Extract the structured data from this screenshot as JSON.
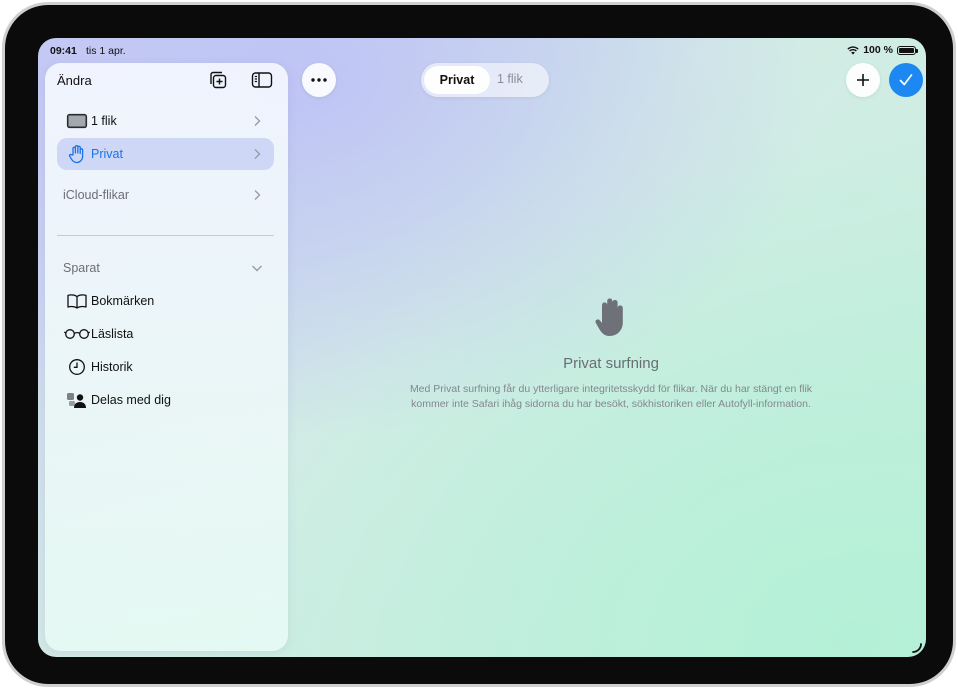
{
  "status_bar": {
    "time": "09:41",
    "date": "tis 1 apr.",
    "battery": "100 %"
  },
  "sidebar": {
    "edit_label": "Ändra",
    "items": [
      {
        "label": "1 flik",
        "icon": "tablet-icon"
      },
      {
        "label": "Privat",
        "icon": "hand-icon",
        "selected": true
      },
      {
        "label": "iCloud-flikar"
      }
    ],
    "saved_section": "Sparat",
    "saved_items": [
      {
        "label": "Bokmärken",
        "icon": "book-icon"
      },
      {
        "label": "Läslista",
        "icon": "glasses-icon"
      },
      {
        "label": "Historik",
        "icon": "clock-icon"
      },
      {
        "label": "Delas med dig",
        "icon": "shared-with-you-icon"
      }
    ]
  },
  "toolbar": {
    "segment_selected": "Privat",
    "segment_other": "1 flik"
  },
  "empty_state": {
    "title": "Privat surfning",
    "body_line1": "Med Privat surfning får du ytterligare integritetsskydd för flikar. När du har stängt en flik",
    "body_line2": "kommer inte Safari ihåg sidorna du har besökt, sökhistoriken eller Autofyll-information."
  },
  "colors": {
    "accent": "#1e88f2",
    "selected_row": "#c8d2f5"
  }
}
